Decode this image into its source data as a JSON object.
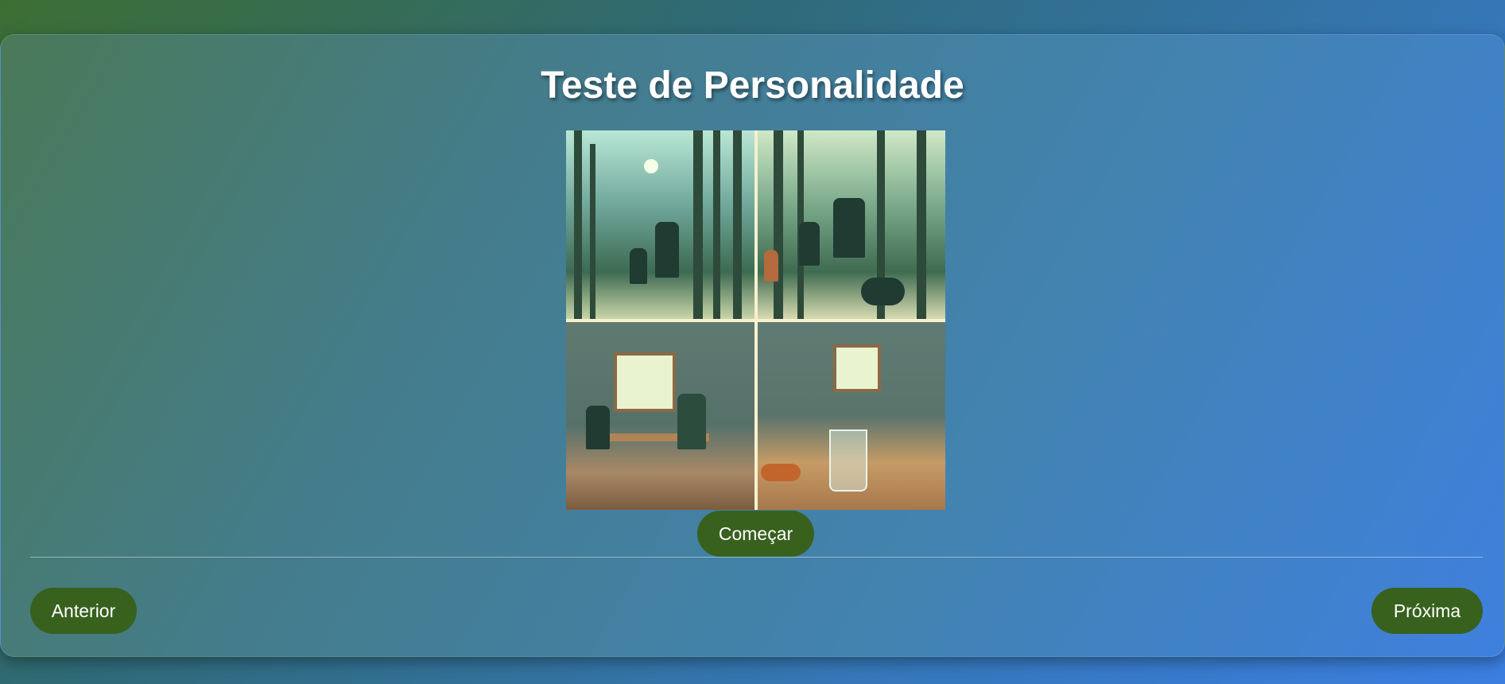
{
  "header": {
    "title": "Teste de Personalidade"
  },
  "quiz": {
    "image_alt": "",
    "start_label": "Começar"
  },
  "navigation": {
    "previous_label": "Anterior",
    "next_label": "Próxima"
  },
  "colors": {
    "button_bg": "#38611e",
    "button_text": "#ffffff",
    "title_text": "#ffffff"
  }
}
